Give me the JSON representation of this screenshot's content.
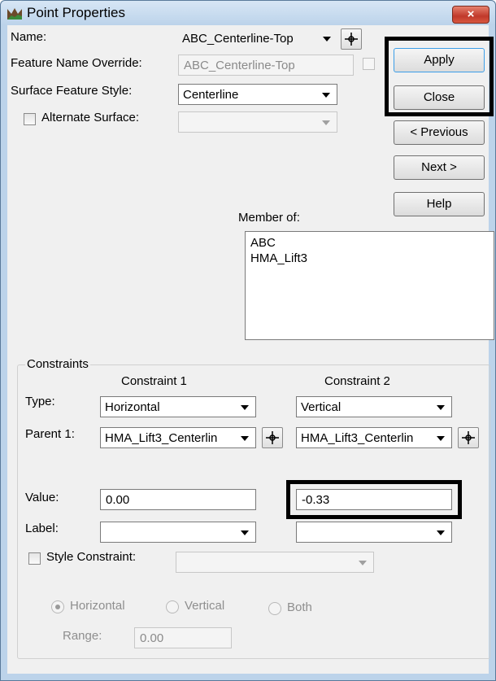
{
  "window": {
    "title": "Point Properties",
    "close_glyph": "×"
  },
  "buttons": {
    "apply": "Apply",
    "close": "Close",
    "previous": "< Previous",
    "next": "Next >",
    "help": "Help"
  },
  "fields": {
    "name_label": "Name:",
    "name_value": "ABC_Centerline-Top",
    "override_label": "Feature Name Override:",
    "override_value": "ABC_Centerline-Top",
    "surface_style_label": "Surface Feature Style:",
    "surface_style_value": "Centerline",
    "alternate_surface_label": "Alternate Surface:",
    "alternate_surface_value": ""
  },
  "member_of": {
    "label": "Member of:",
    "items": [
      "ABC",
      "HMA_Lift3"
    ]
  },
  "constraints": {
    "group_label": "Constraints",
    "c1_header": "Constraint 1",
    "c2_header": "Constraint 2",
    "type_label": "Type:",
    "parent_label": "Parent 1:",
    "value_label": "Value:",
    "label_label": "Label:",
    "c1": {
      "type": "Horizontal",
      "parent": "HMA_Lift3_Centerlin",
      "value": "0.00",
      "label": ""
    },
    "c2": {
      "type": "Vertical",
      "parent": "HMA_Lift3_Centerlin",
      "value": "-0.33",
      "label": ""
    },
    "style_constraint_label": "Style Constraint:",
    "style_constraint_value": "",
    "radio_horizontal": "Horizontal",
    "radio_vertical": "Vertical",
    "radio_both": "Both",
    "range_label": "Range:",
    "range_value": "0.00"
  },
  "colors": {
    "title_bar": "#bcd3ea",
    "dialog_bg": "#f0f0f0",
    "close_button": "#c0392b",
    "highlight": "#000000",
    "apply_focus": "#3c9ee8"
  }
}
